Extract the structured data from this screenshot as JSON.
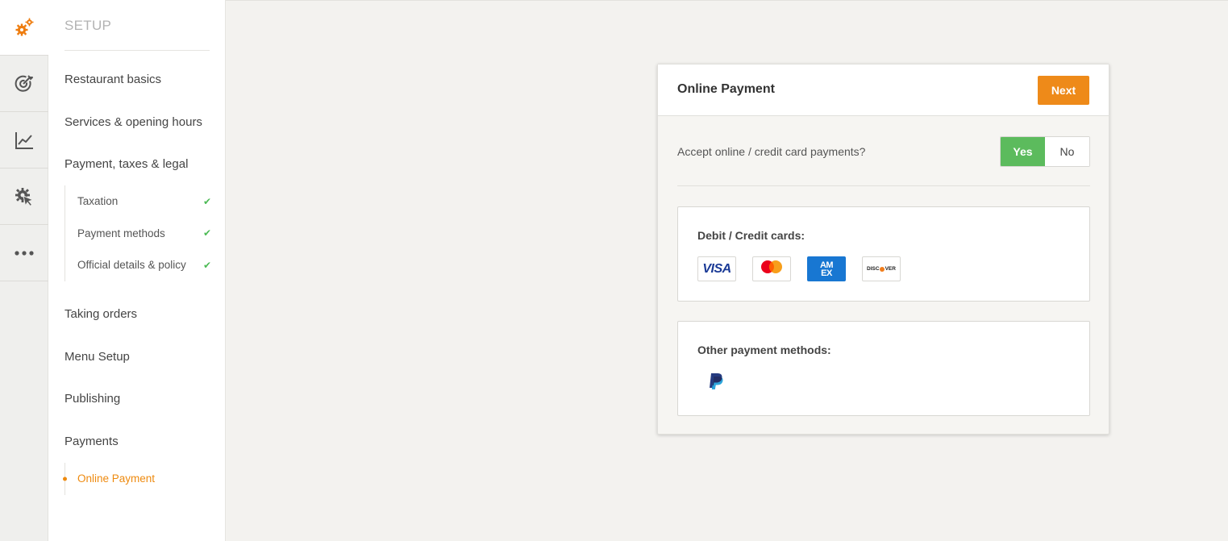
{
  "sidebar": {
    "title": "SETUP",
    "items": [
      {
        "label": "Restaurant basics"
      },
      {
        "label": "Services & opening hours"
      },
      {
        "label": "Payment, taxes & legal"
      },
      {
        "label": "Taking orders"
      },
      {
        "label": "Menu Setup"
      },
      {
        "label": "Publishing"
      },
      {
        "label": "Payments"
      }
    ],
    "payment_sub": [
      {
        "label": "Taxation",
        "status": "✔"
      },
      {
        "label": "Payment methods",
        "status": "✔"
      },
      {
        "label": "Official details & policy",
        "status": "✔"
      }
    ],
    "payments_sub": [
      {
        "label": "Online Payment"
      }
    ]
  },
  "rail": {
    "icons": [
      "gears-icon",
      "target-icon",
      "chart-line-icon",
      "gear-cursor-icon",
      "more-dots-icon"
    ]
  },
  "card": {
    "title": "Online Payment",
    "next_label": "Next",
    "question": "Accept online / credit card payments?",
    "toggle": {
      "yes": "Yes",
      "no": "No",
      "selected": "Yes"
    },
    "cards_title": "Debit / Credit cards:",
    "brands": {
      "visa": "VISA",
      "amex_top": "AM",
      "amex_bottom": "EX",
      "discover_a": "DISC",
      "discover_b": "VER"
    },
    "other_title": "Other payment methods:"
  },
  "colors": {
    "accent": "#ee8a19",
    "success": "#5cbb5d",
    "check": "#4cba55"
  }
}
